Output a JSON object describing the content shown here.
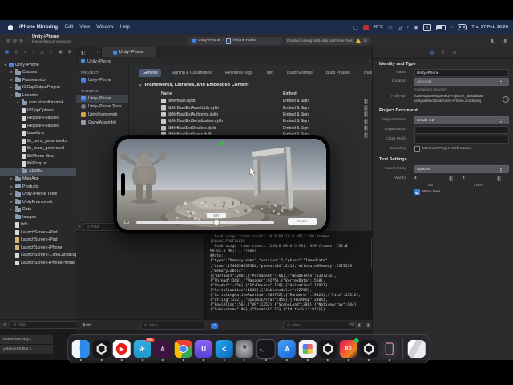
{
  "menu_bar": {
    "app_name": "iPhone Mirroring",
    "menus": [
      "Edit",
      "View",
      "Window",
      "Help"
    ],
    "status_temp": "40°C",
    "keyboard_layout": "A",
    "clock": "Thu 27 Feb 16:26"
  },
  "toolbar": {
    "project_name": "Unity-iPhone",
    "branch": "feature/fracturing-window",
    "scheme": "Unity-iPhone",
    "run_destination": "iPhone Pavlo",
    "status_message": "Finished running blast-unity on iPhone Pavlo",
    "warning_count": "15",
    "add_label": "+"
  },
  "editor_tab": "Unity-iPhone",
  "breadcrumb": "Unity-iPhone",
  "navigator": {
    "filter_placeholder": "Filter",
    "items": [
      {
        "label": "Unity-iPhone",
        "level": 0,
        "disc": "v",
        "icon": "proj"
      },
      {
        "label": "Classes",
        "level": 1,
        "disc": "r",
        "icon": "fold"
      },
      {
        "label": "Frameworks",
        "level": 1,
        "disc": "r",
        "icon": "fold"
      },
      {
        "label": "Il2CppOutputProject",
        "level": 1,
        "disc": "r",
        "icon": "fold"
      },
      {
        "label": "Libraries",
        "level": 1,
        "disc": "v",
        "icon": "fold"
      },
      {
        "label": "com.pixeption.mok",
        "level": 2,
        "disc": "r",
        "icon": "fold"
      },
      {
        "label": "Il2CppOptions",
        "level": 2,
        "disc": "",
        "icon": "file"
      },
      {
        "label": "RegisterFeatures",
        "level": 2,
        "disc": "",
        "icon": "file"
      },
      {
        "label": "RegisterFeatures",
        "level": 2,
        "disc": "",
        "icon": "file"
      },
      {
        "label": "baselib.a",
        "level": 2,
        "disc": "",
        "icon": "file"
      },
      {
        "label": "lib_burst_generated.a",
        "level": 2,
        "disc": "",
        "icon": "file"
      },
      {
        "label": "lib_burst_generated",
        "level": 2,
        "disc": "",
        "icon": "file"
      },
      {
        "label": "libiPhone-lib.a",
        "level": 2,
        "disc": "",
        "icon": "file"
      },
      {
        "label": "libIl2cpp.a",
        "level": 2,
        "disc": "",
        "icon": "file"
      },
      {
        "label": "ARM64",
        "level": 2,
        "disc": "r",
        "icon": "fold",
        "selected": true
      },
      {
        "label": "MainApp",
        "level": 1,
        "disc": "r",
        "icon": "fold"
      },
      {
        "label": "Products",
        "level": 1,
        "disc": "r",
        "icon": "fold"
      },
      {
        "label": "Unity-iPhone Tests",
        "level": 1,
        "disc": "r",
        "icon": "fold"
      },
      {
        "label": "UnityFramework",
        "level": 1,
        "disc": "r",
        "icon": "fold"
      },
      {
        "label": "Data",
        "level": 1,
        "disc": "r",
        "icon": "fold"
      },
      {
        "label": "Images",
        "level": 1,
        "disc": "",
        "icon": "fold"
      },
      {
        "label": "Info",
        "level": 1,
        "disc": "",
        "icon": "file"
      },
      {
        "label": "LaunchScreen-iPad",
        "level": 1,
        "disc": "",
        "icon": "file"
      },
      {
        "label": "LaunchScreen-iPad",
        "level": 1,
        "disc": "",
        "icon": "xib"
      },
      {
        "label": "LaunchScreen-iPhone",
        "level": 1,
        "disc": "",
        "icon": "xib"
      },
      {
        "label": "LaunchScreen-...oneLandscape",
        "level": 1,
        "disc": "",
        "icon": "file"
      },
      {
        "label": "LaunchScreen-iPhonePortrait",
        "level": 1,
        "disc": "",
        "icon": "file"
      }
    ]
  },
  "project_pane": {
    "project_header": "PROJECT",
    "project_name": "Unity-iPhone",
    "targets_header": "TARGETS",
    "targets": [
      {
        "name": "Unity-iPhone",
        "icon": "app",
        "selected": true
      },
      {
        "name": "Unity-iPhone Tests",
        "icon": "test"
      },
      {
        "name": "UnityFramework",
        "icon": "fw"
      },
      {
        "name": "GameAssembly",
        "icon": "lib"
      }
    ],
    "filter_placeholder": "Filter"
  },
  "settings": {
    "tabs": [
      "General",
      "Signing & Capabilities",
      "Resource Tags",
      "Info",
      "Build Settings",
      "Build Phases",
      "Build Rules"
    ],
    "active_tab": "General",
    "section_title": "Frameworks, Libraries, and Embedded Content",
    "col_name": "Name",
    "col_embed": "Embed",
    "frameworks": [
      {
        "name": "libNvBlast.dylib",
        "embed": "Embed & Sign"
      },
      {
        "name": "libNvBlastExtAssetUtils.dylib",
        "embed": "Embed & Sign"
      },
      {
        "name": "libNvBlastExtAuthoring.dylib",
        "embed": "Embed & Sign"
      },
      {
        "name": "libNvBlastExtSerialization.dylib",
        "embed": "Embed & Sign"
      },
      {
        "name": "libNvBlastExtShaders.dylib",
        "embed": "Embed & Sign"
      },
      {
        "name": "libNvBlastExtStress.dylib",
        "embed": "Embed & Sign"
      }
    ]
  },
  "inspector": {
    "identity_header": "Identity and Type",
    "name_label": "Name",
    "name_value": "Unity-iPhone",
    "location_label": "Location",
    "location_value": "Absolute",
    "containing_dir": "Containing directory",
    "full_path_label": "Full Path",
    "full_path_line1": "/Users/pavelsupenko/Projects/_blast/blast-",
    "full_path_line2": "unity/artifacts/ios/Unity-iPhone.xcodeproj",
    "document_header": "Project Document",
    "format_label": "Project Format",
    "format_value": "Xcode 3.2",
    "organization_label": "Organization",
    "class_prefix_label": "Class Prefix",
    "encoding_label": "Encoding",
    "minimize_label": "Minimize Project References",
    "text_settings_header": "Text Settings",
    "indent_label": "Indent Using",
    "indent_value": "Spaces",
    "widths_label": "Widths",
    "tab_width": "4",
    "indent_width": "4",
    "tab_sublabel": "Tab",
    "indent_sublabel": "Indent",
    "wrap_label": "Wrap lines"
  },
  "debug": {
    "variables_scope": "Auto",
    "variables_filter": "Filter",
    "console_badge": "2",
    "console_filter": "Filter",
    "console_lines": [
      "  Peak usage frame count: [8.0 MB-16.0 MB]: 360 frames",
      "[ALLOC_PROFILER]",
      "  Peak usage frame count: [256.0 KB-0.5 MB]: 359 frames, [32.0",
      "MB-64.0 MB]: 1 frames",
      "##utp:",
      "{\"type\":\"MemoryLeaks\",\"version\":2,\"phase\":\"Immediate\"",
      ",\"time\":1740650639586,\"processId\":2413,\"allocatedMemory\":2372359",
      ",\"memoryLabels\":",
      "[{\"Default\":288},{\"Permanent\":-66},{\"NewDelete\":1337216},",
      "{\"Thread\":168},{\"Manager\":9275},{\"VertexData\":1568},",
      "{\"Shader\":-456},{\"GfxDevice\":128},{\"Animation\":17923},",
      "{\"Serialization\":1648},{\"JobScheduler\":32768},",
      "{\"ScriptingNativeRuntime\":960752},{\"Renderer\":19124},{\"File\":13312},",
      "{\"String\":112},{\"DynamicArray\":456},{\"HashMap\":2304},",
      "{\"PoolAlloc\":56},{\"VR\":1752},{\"SceneLoad\":288},{\"NativeArray\":944},",
      "{\"Subsystems\":96},{\"BaseLib\":16},{\"EditorGui\":816}]}"
    ]
  },
  "mirror": {
    "fps": "60",
    "slider_label": "L0",
    "value_chip": "597",
    "reset_label": "Reset"
  },
  "dock": {
    "apps": [
      {
        "name": "finder"
      },
      {
        "name": "unity-hub"
      },
      {
        "name": "youtube"
      },
      {
        "name": "telegram",
        "badge": "666"
      },
      {
        "name": "slack"
      },
      {
        "name": "chrome"
      },
      {
        "name": "utm"
      },
      {
        "name": "vscode"
      },
      {
        "name": "system-settings"
      },
      {
        "name": "terminal"
      },
      {
        "name": "xcode"
      },
      {
        "name": "launchpad"
      },
      {
        "name": "unity"
      },
      {
        "name": "rider",
        "ok_badge": true
      },
      {
        "name": "unity-editor"
      },
      {
        "name": "iphone-mirroring"
      },
      {
        "name": "trash"
      }
    ]
  },
  "background_window": {
    "tabs": [
      "arataAssembly.c",
      "y.Blaster.Editor.c"
    ]
  },
  "colors": {
    "accent_blue": "#3f7bd9",
    "warning_yellow": "#f0b429",
    "fps_green": "#35d435",
    "menu_bar_blue": "#1c2b49"
  }
}
